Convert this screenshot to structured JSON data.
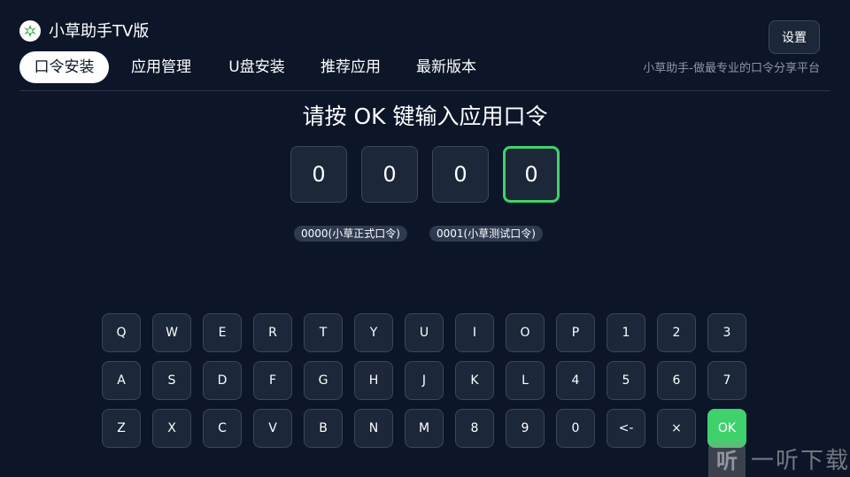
{
  "header": {
    "title": "小草助手TV版",
    "settings_label": "设置",
    "slogan": "小草助手-做最专业的口令分享平台",
    "logo_icon": "grass-logo-icon"
  },
  "tabs": [
    {
      "label": "口令安装",
      "active": true
    },
    {
      "label": "应用管理",
      "active": false
    },
    {
      "label": "U盘安装",
      "active": false
    },
    {
      "label": "推荐应用",
      "active": false
    },
    {
      "label": "最新版本",
      "active": false
    }
  ],
  "main": {
    "prompt": "请按 OK 键输入应用口令",
    "code_digits": [
      "0",
      "0",
      "0",
      "0"
    ],
    "focused_digit_index": 3,
    "suggestions": [
      "0000(小草正式口令)",
      "0001(小草测试口令)"
    ]
  },
  "keyboard": {
    "rows": [
      [
        "Q",
        "W",
        "E",
        "R",
        "T",
        "Y",
        "U",
        "I",
        "O",
        "P",
        "1",
        "2",
        "3"
      ],
      [
        "A",
        "S",
        "D",
        "F",
        "G",
        "H",
        "J",
        "K",
        "L",
        "4",
        "5",
        "6",
        "7"
      ],
      [
        "Z",
        "X",
        "C",
        "V",
        "B",
        "N",
        "M",
        "8",
        "9",
        "0",
        "<-",
        "×",
        "OK"
      ]
    ]
  },
  "watermark": {
    "mark": "听",
    "text": "一听下载"
  },
  "colors": {
    "background": "#0c1628",
    "key_bg": "#1c2739",
    "accent_green": "#3fd26c",
    "muted_text": "#8d96a6"
  }
}
